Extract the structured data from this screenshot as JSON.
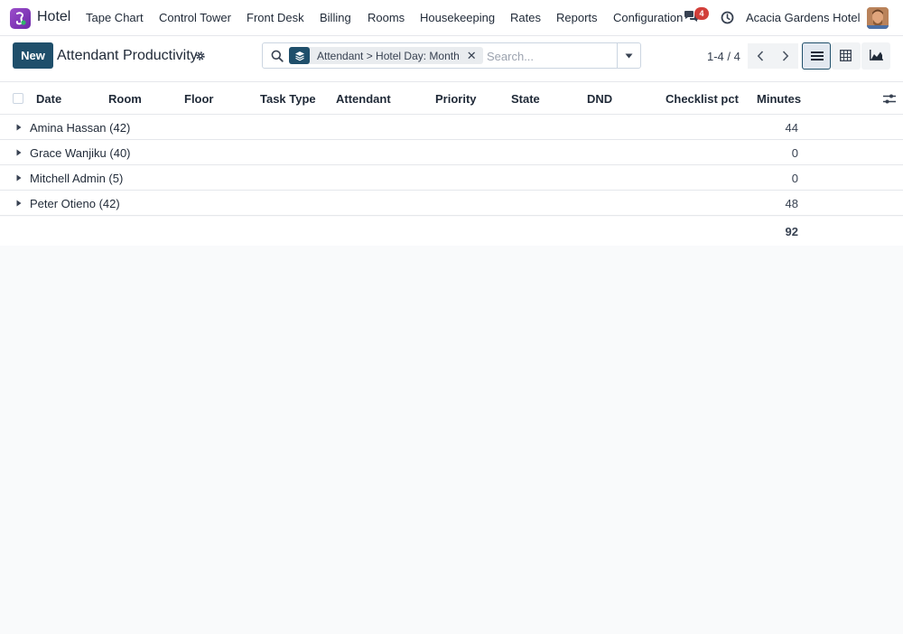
{
  "navbar": {
    "app_name": "Hotel",
    "menu": [
      {
        "label": "Tape Chart"
      },
      {
        "label": "Control Tower"
      },
      {
        "label": "Front Desk"
      },
      {
        "label": "Billing"
      },
      {
        "label": "Rooms"
      },
      {
        "label": "Housekeeping"
      },
      {
        "label": "Rates"
      },
      {
        "label": "Reports"
      },
      {
        "label": "Configuration"
      }
    ],
    "messages_count": "4",
    "company": "Acacia Gardens Hotel",
    "icons": {
      "app_logo": "app-logo-icon",
      "messages": "chat-bubbles-icon",
      "activity": "clock-icon",
      "user": "avatar"
    }
  },
  "control_panel": {
    "new_button": "New",
    "title": "Attendant Productivity",
    "search": {
      "facet_label": "Attendant > Hotel Day: Month",
      "placeholder": "Search..."
    },
    "pager": "1-4 / 4",
    "views": [
      "list",
      "pivot",
      "graph"
    ],
    "active_view": "list"
  },
  "list": {
    "columns": [
      "Date",
      "Room",
      "Floor",
      "Task Type",
      "Attendant",
      "Priority",
      "State",
      "DND",
      "Checklist pct",
      "Minutes"
    ],
    "groups": [
      {
        "name": "Amina Hassan (42)",
        "minutes": "44"
      },
      {
        "name": "Grace Wanjiku (40)",
        "minutes": "0"
      },
      {
        "name": "Mitchell Admin (5)",
        "minutes": "0"
      },
      {
        "name": "Peter Otieno (42)",
        "minutes": "48"
      }
    ],
    "total_minutes": "92"
  },
  "colors": {
    "primary": "#1f4f6b",
    "brand": "#7b3fb5",
    "badge": "#d23f3a"
  }
}
